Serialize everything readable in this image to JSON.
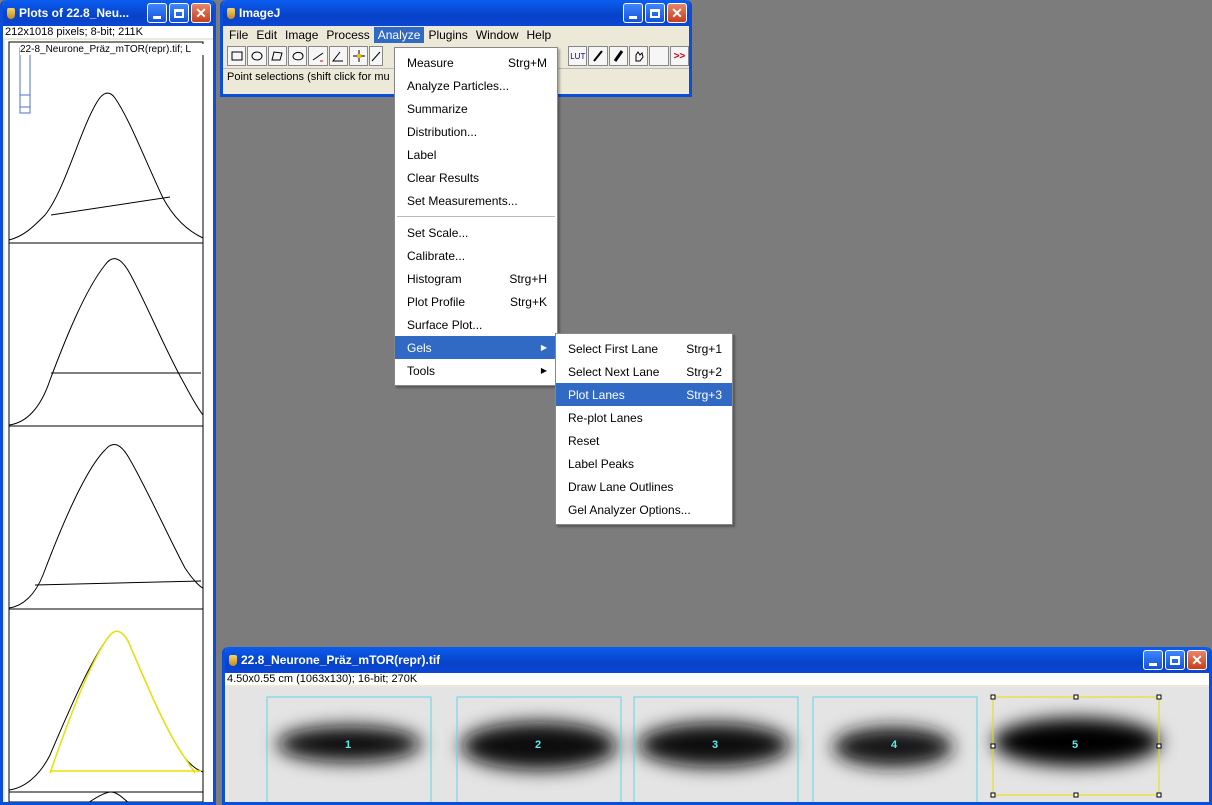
{
  "plots_window": {
    "title": "Plots of 22.8_Neu...",
    "info": "212x1018 pixels; 8-bit; 211K",
    "caption": "22-8_Neurone_Präz_mTOR(repr).tif; L"
  },
  "imagej_window": {
    "title": "ImageJ",
    "menus": [
      "File",
      "Edit",
      "Image",
      "Process",
      "Analyze",
      "Plugins",
      "Window",
      "Help"
    ],
    "status": "Point selections (shift click for mu",
    "toolbar": {
      "lut_label": "LUT",
      "more_label": ">>"
    }
  },
  "analyze_menu": {
    "items": [
      {
        "label": "Measure",
        "shortcut": "Strg+M"
      },
      {
        "label": "Analyze Particles...",
        "shortcut": ""
      },
      {
        "label": "Summarize",
        "shortcut": ""
      },
      {
        "label": "Distribution...",
        "shortcut": ""
      },
      {
        "label": "Label",
        "shortcut": ""
      },
      {
        "label": "Clear Results",
        "shortcut": ""
      },
      {
        "label": "Set Measurements...",
        "shortcut": ""
      },
      {
        "label": "Set Scale...",
        "shortcut": ""
      },
      {
        "label": "Calibrate...",
        "shortcut": ""
      },
      {
        "label": "Histogram",
        "shortcut": "Strg+H"
      },
      {
        "label": "Plot Profile",
        "shortcut": "Strg+K"
      },
      {
        "label": "Surface Plot...",
        "shortcut": ""
      },
      {
        "label": "Gels",
        "shortcut": ""
      },
      {
        "label": "Tools",
        "shortcut": ""
      }
    ]
  },
  "gels_menu": {
    "items": [
      {
        "label": "Select First Lane",
        "shortcut": "Strg+1"
      },
      {
        "label": "Select Next Lane",
        "shortcut": "Strg+2"
      },
      {
        "label": "Plot Lanes",
        "shortcut": "Strg+3"
      },
      {
        "label": "Re-plot Lanes",
        "shortcut": ""
      },
      {
        "label": "Reset",
        "shortcut": ""
      },
      {
        "label": "Label Peaks",
        "shortcut": ""
      },
      {
        "label": "Draw Lane Outlines",
        "shortcut": ""
      },
      {
        "label": "Gel Analyzer Options...",
        "shortcut": ""
      }
    ]
  },
  "gel_window": {
    "title": "22.8_Neurone_Präz_mTOR(repr).tif",
    "info": "4.50x0.55 cm (1063x130); 16-bit; 270K",
    "lanes": [
      "1",
      "2",
      "3",
      "4",
      "5"
    ]
  },
  "colors": {
    "title_bar": "#0a47d2",
    "highlight": "#316ac5",
    "selected_lane": "#e8e000",
    "lane_outline": "#5fd6e6"
  }
}
